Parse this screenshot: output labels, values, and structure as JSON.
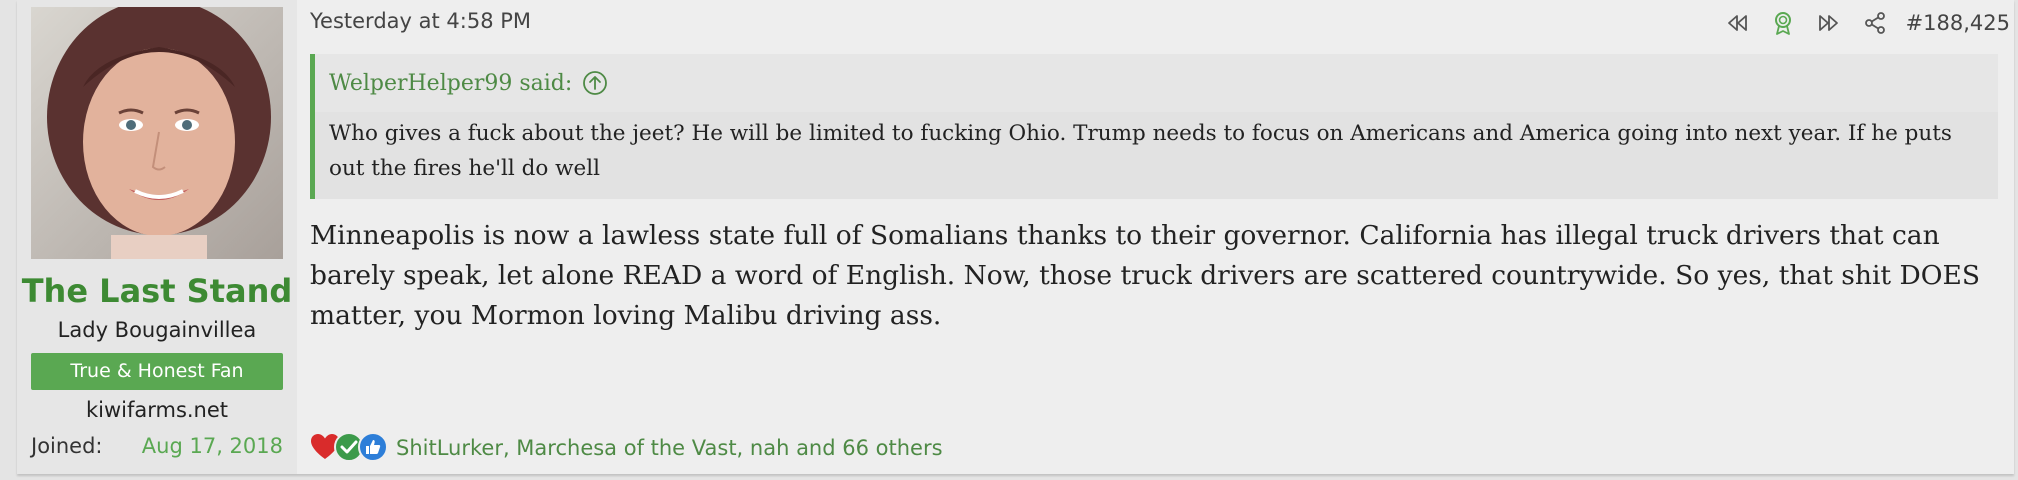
{
  "user": {
    "username": "The Last Stand",
    "title": "Lady Bougainvillea",
    "banner": "True & Honest Fan",
    "site": "kiwifarms.net",
    "joined_label": "Joined:",
    "joined_date": "Aug 17, 2018"
  },
  "post": {
    "timestamp": "Yesterday at 4:58 PM",
    "number": "#188,425",
    "quote": {
      "author_said": "WelperHelper99 said:",
      "text": "Who gives a fuck about the jeet? He will be limited to fucking Ohio. Trump needs to focus on Americans and America going into next year. If he puts out the fires he'll do well"
    },
    "message": "Minneapolis is now a lawless state full of Somalians thanks to their governor. California has illegal truck drivers that can barely speak, let alone READ a word of English. Now, those truck drivers are scattered countrywide. So yes, that shit DOES matter, you Mormon loving Malibu driving ass.",
    "reactions_text": "ShitLurker, Marchesa of the Vast, nah and 66 others"
  },
  "icons": {
    "actions": [
      "rewind-icon",
      "ribbon-icon",
      "fast-forward-icon",
      "share-icon"
    ],
    "reactions": [
      "heart-icon",
      "check-icon",
      "thumbs-up-icon"
    ]
  },
  "colors": {
    "accent_green": "#5aa852",
    "link_green": "#4e8a45",
    "username_green": "#3d8a33",
    "background": "#eeeeee"
  }
}
